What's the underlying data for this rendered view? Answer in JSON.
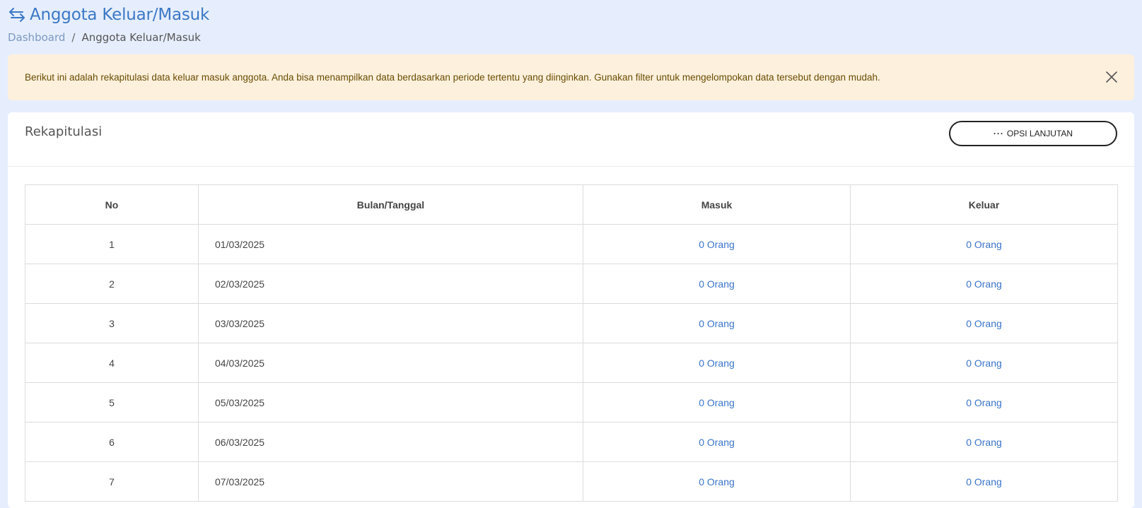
{
  "page": {
    "title": "Anggota Keluar/Masuk",
    "icon": "swap-arrows-icon"
  },
  "breadcrumb": {
    "home": "Dashboard",
    "separator": "/",
    "current": "Anggota Keluar/Masuk"
  },
  "alert": {
    "text": "Berikut ini adalah rekapitulasi data keluar masuk anggota. Anda bisa menampilkan data berdasarkan periode tertentu yang diinginkan. Gunakan filter untuk mengelompokan data tersebut dengan mudah."
  },
  "card": {
    "title": "Rekapitulasi",
    "options_button": "OPSI LANJUTAN",
    "options_icon": "···"
  },
  "table": {
    "headers": [
      "No",
      "Bulan/Tanggal",
      "Masuk",
      "Keluar"
    ],
    "rows": [
      {
        "no": "1",
        "date": "01/03/2025",
        "masuk": "0 Orang",
        "keluar": "0 Orang"
      },
      {
        "no": "2",
        "date": "02/03/2025",
        "masuk": "0 Orang",
        "keluar": "0 Orang"
      },
      {
        "no": "3",
        "date": "03/03/2025",
        "masuk": "0 Orang",
        "keluar": "0 Orang"
      },
      {
        "no": "4",
        "date": "04/03/2025",
        "masuk": "0 Orang",
        "keluar": "0 Orang"
      },
      {
        "no": "5",
        "date": "05/03/2025",
        "masuk": "0 Orang",
        "keluar": "0 Orang"
      },
      {
        "no": "6",
        "date": "06/03/2025",
        "masuk": "0 Orang",
        "keluar": "0 Orang"
      },
      {
        "no": "7",
        "date": "07/03/2025",
        "masuk": "0 Orang",
        "keluar": "0 Orang"
      }
    ]
  },
  "colors": {
    "accent": "#3b78c6",
    "link": "#3a74c9",
    "page_bg": "#e6eefd",
    "alert_bg": "#fdf0dd",
    "alert_text": "#6a4d04"
  }
}
